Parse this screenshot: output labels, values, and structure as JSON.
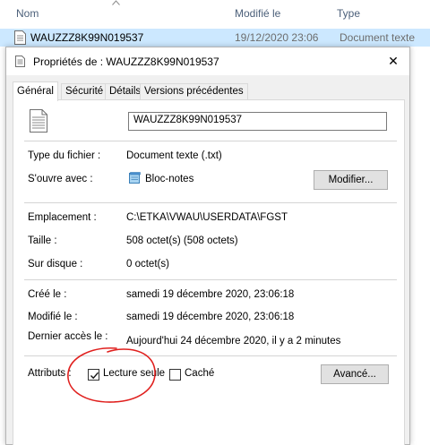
{
  "explorer": {
    "columns": [
      "Nom",
      "Modifié le",
      "Type"
    ],
    "file": {
      "name": "WAUZZZ8K99N019537",
      "modified": "19/12/2020 23:06",
      "type": "Document texte"
    }
  },
  "dialog": {
    "title": "Propriétés de : WAUZZZ8K99N019537",
    "close_glyph": "✕",
    "tabs": [
      "Général",
      "Sécurité",
      "Détails",
      "Versions précédentes"
    ],
    "active_tab": "Général",
    "file_name": "WAUZZZ8K99N019537",
    "rows": {
      "type_label": "Type du fichier :",
      "type_value": "Document texte (.txt)",
      "opens_label": "S'ouvre avec :",
      "opens_value": "Bloc-notes",
      "modify_button": "Modifier...",
      "location_label": "Emplacement :",
      "location_value": "C:\\ETKA\\VWAU\\USERDATA\\FGST",
      "size_label": "Taille :",
      "size_value": "508 octet(s) (508 octets)",
      "disk_label": "Sur disque :",
      "disk_value": "0 octet(s)",
      "created_label": "Créé le :",
      "created_value": "samedi 19 décembre 2020, 23:06:18",
      "modified_label": "Modifié le :",
      "modified_value": "samedi 19 décembre 2020, 23:06:18",
      "accessed_label": "Dernier accès le :",
      "accessed_value": "Aujourd'hui 24 décembre 2020, il y a 2 minutes"
    },
    "attributes": {
      "label": "Attributs :",
      "readonly_label": "Lecture seule",
      "readonly_checked": true,
      "hidden_label": "Caché",
      "hidden_checked": false,
      "advanced_button": "Avancé..."
    },
    "annotation_color": "#e0201e"
  }
}
